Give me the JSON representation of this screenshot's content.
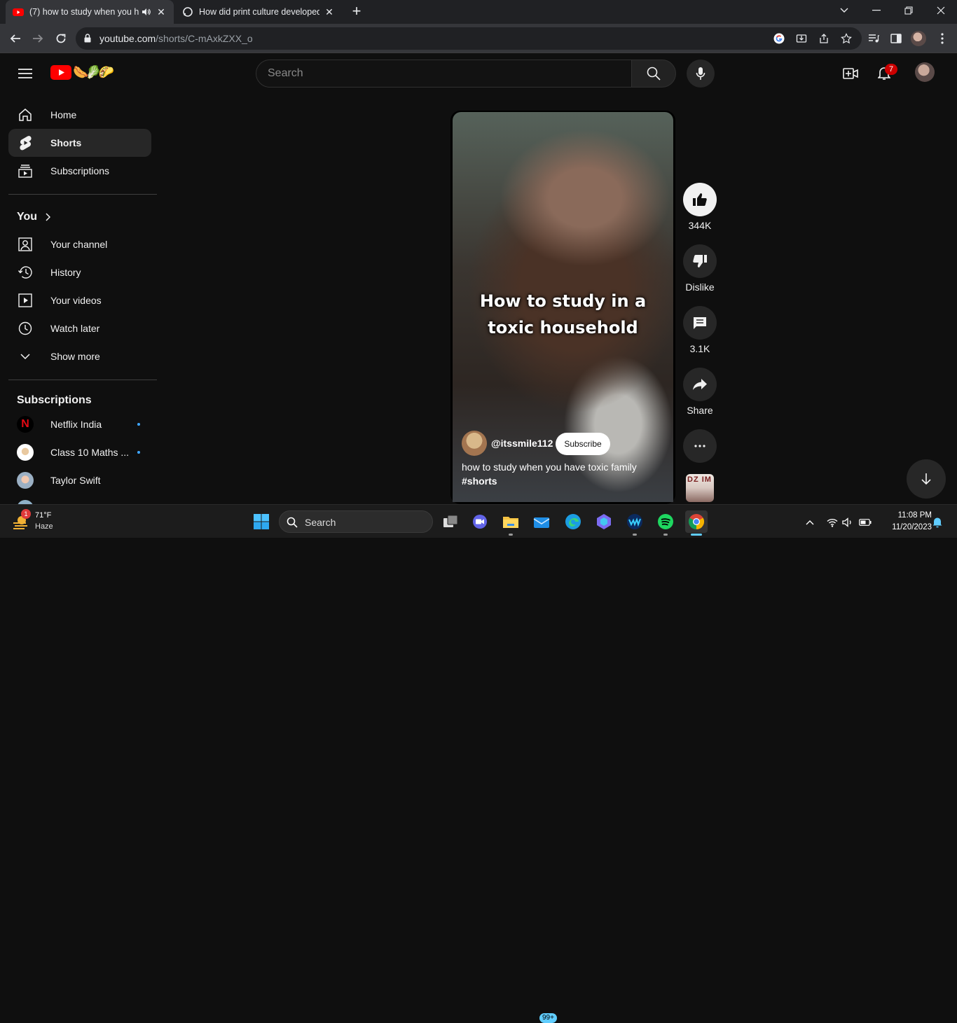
{
  "browser": {
    "tabs": [
      {
        "title": "(7) how to study when you h",
        "active": true
      },
      {
        "title": "How did print culture developed",
        "active": false
      }
    ],
    "url_host": "youtube.com",
    "url_path": "/shorts/C-mAxkZXX_o"
  },
  "header": {
    "search_placeholder": "Search",
    "notification_count": "7"
  },
  "sidebar": {
    "main": [
      {
        "label": "Home",
        "icon": "home-icon"
      },
      {
        "label": "Shorts",
        "icon": "shorts-icon",
        "active": true
      },
      {
        "label": "Subscriptions",
        "icon": "subscriptions-icon"
      }
    ],
    "you_heading": "You",
    "you": [
      {
        "label": "Your channel",
        "icon": "account-icon"
      },
      {
        "label": "History",
        "icon": "history-icon"
      },
      {
        "label": "Your videos",
        "icon": "video-icon"
      },
      {
        "label": "Watch later",
        "icon": "clock-icon"
      },
      {
        "label": "Show more",
        "icon": "chevron-down-icon"
      }
    ],
    "subscriptions_heading": "Subscriptions",
    "subscriptions": [
      {
        "label": "Netflix India",
        "new": true
      },
      {
        "label": "Class 10 Maths ...",
        "new": true
      },
      {
        "label": "Taylor Swift",
        "new": false
      }
    ]
  },
  "short": {
    "caption_line1": "How to study in a",
    "caption_line2": "toxic household",
    "channel_handle": "@itssmile112",
    "subscribe_label": "Subscribe",
    "description": "how to study when you have toxic family",
    "hashtag": "#shorts",
    "sound_thumb_text": "DZ IM"
  },
  "actions": {
    "likes": "344K",
    "dislike_label": "Dislike",
    "comments": "3.1K",
    "share_label": "Share"
  },
  "taskbar": {
    "weather_temp": "71°F",
    "weather_cond": "Haze",
    "weather_badge": "1",
    "search_label": "Search",
    "mail_badge": "99+",
    "time": "11:08 PM",
    "date": "11/20/2023"
  }
}
